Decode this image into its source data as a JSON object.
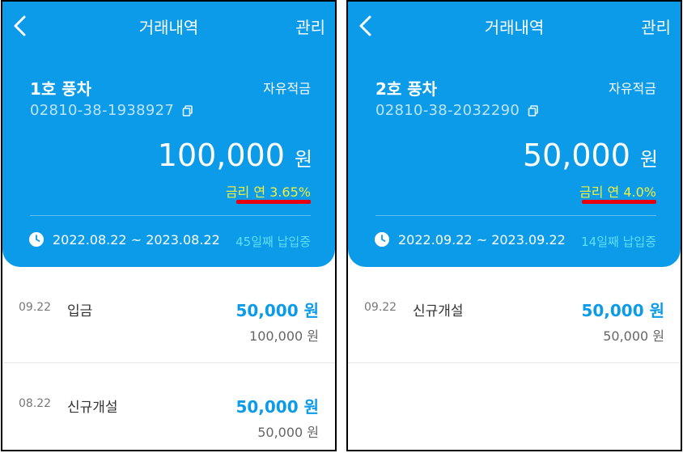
{
  "panels": [
    {
      "header": {
        "title": "거래내역",
        "manage_label": "관리"
      },
      "account": {
        "name": "1호 풍차",
        "type": "자유적금",
        "number": "02810-38-1938927",
        "balance": "100,000",
        "unit": "원",
        "rate": "금리 연 3.65%",
        "period": "2022.08.22 ~ 2023.08.22",
        "status": "45일째 납입중"
      },
      "transactions": [
        {
          "date": "09.22",
          "desc": "입금",
          "amount": "50,000 원",
          "balance": "100,000 원"
        },
        {
          "date": "08.22",
          "desc": "신규개설",
          "amount": "50,000 원",
          "balance": "50,000 원"
        }
      ]
    },
    {
      "header": {
        "title": "거래내역",
        "manage_label": "관리"
      },
      "account": {
        "name": "2호 풍차",
        "type": "자유적금",
        "number": "02810-38-2032290",
        "balance": "50,000",
        "unit": "원",
        "rate": "금리 연 4.0%",
        "period": "2022.09.22 ~ 2023.09.22",
        "status": "14일째 납입중"
      },
      "transactions": [
        {
          "date": "09.22",
          "desc": "신규개설",
          "amount": "50,000 원",
          "balance": "50,000 원"
        }
      ]
    }
  ],
  "colors": {
    "brand": "#0b9be8",
    "rate_text": "#f4ef3a",
    "highlight": "#e8000f",
    "status": "#5fe0f5"
  },
  "icons": {
    "back": "chevron-left-icon",
    "copy": "copy-icon",
    "clock": "clock-icon"
  }
}
